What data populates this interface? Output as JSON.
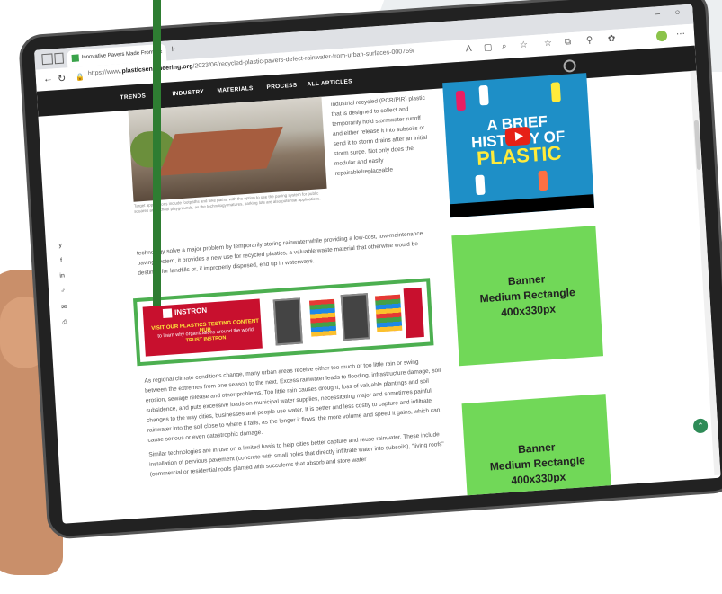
{
  "browser": {
    "tab_title": "Innovative Pavers Made From",
    "tab_close": "×",
    "new_tab": "+",
    "url_prefix": "https://www.",
    "url_domain": "plasticsengineering.org",
    "url_path": "/2023/06/recycled-plastic-pavers-defect-rainwater-from-urban-surfaces-000759/",
    "minimize": "–",
    "restore": "○"
  },
  "site_nav": {
    "items": [
      "TRENDS",
      "INDUSTRY",
      "MATERIALS",
      "PROCESS",
      "ALL ARTICLES"
    ]
  },
  "social": [
    "y",
    "f",
    "in",
    "♂",
    "✉",
    "⎙"
  ],
  "article": {
    "image_caption": "Target applications include footpaths and bike paths, with the option to use the paving system for public squares and school playgrounds, as the technology matures, parking lots are also potential applications.",
    "side_text": "industrial recycled (PCR/PIR) plastic that is designed to collect and temporarily hold stormwater runoff and either release it into subsoils or send it to storm drains after an initial storm surge. Not only does the modular and easily repairable/replaceable",
    "full_text": "technology solve a major problem by temporarily storing rainwater while providing a low-cost, low-maintenance paving system, it provides a new use for recycled plastics, a valuable waste material that otherwise would be destined for landfills or, if improperly disposed, end up in waterways.",
    "body_p1": "As regional climate conditions change, many urban areas receive either too much or too little rain or swing between the extremes from one season to the next. Excess rainwater leads to flooding, infrastructure damage, soil erosion, sewage release and other problems. Too little rain causes drought, loss of valuable plantings and soil subsidence, and puts excessive loads on municipal water supplies, necessitating major and sometimes painful changes to the way cities, businesses and people use water. It is better and less costly to capture and infiltrate rainwater into the soil close to where it falls, as the longer it flows, the more volume and speed it gains, which can cause serious or even catastrophic damage.",
    "body_p2": "Similar technologies are in use on a limited basis to help cities better capture and reuse rainwater. These include installation of pervious pavement (concrete with small holes that directly infiltrate water into subsoils), \"living roofs\" (commercial or residential roofs planted with succulents that absorb and store water"
  },
  "ad": {
    "brand": "INSTRON",
    "headline": "VISIT OUR PLASTICS TESTING CONTENT HUB",
    "sub": "to learn why organizations around the world",
    "sub_highlight": "TRUST INSTRON"
  },
  "video": {
    "line1": "A BRIEF",
    "line2a": "HIST",
    "line2b": "Y OF",
    "line3": "PLASTIC"
  },
  "banners": [
    {
      "line1": "Banner",
      "line2": "Medium Rectangle",
      "line3": "400x330px"
    },
    {
      "line1": "Banner",
      "line2": "Medium Rectangle",
      "line3": "400x330px"
    }
  ],
  "scroll_top": "⌃",
  "colors": {
    "accent_green": "#2e7d32",
    "banner_green": "#71d858",
    "nav_bg": "#1e1e1e",
    "ad_red": "#c8102e",
    "video_blue": "#1e8fc7"
  }
}
